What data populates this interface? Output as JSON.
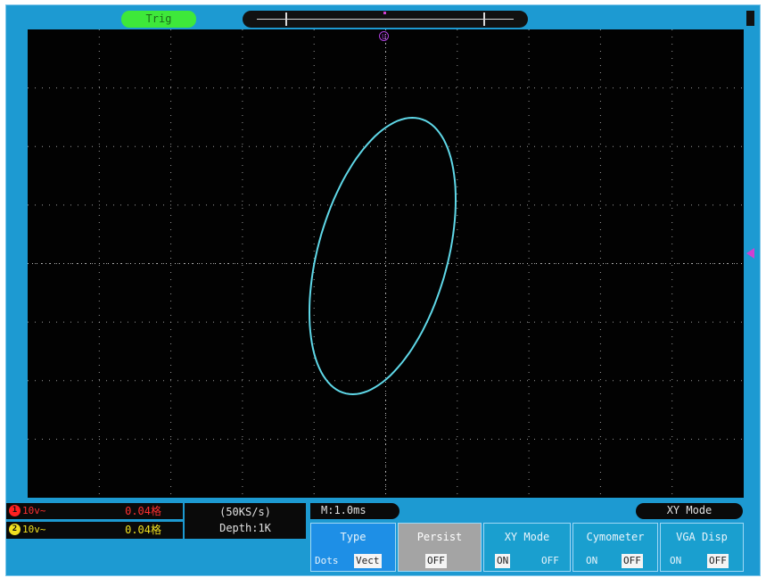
{
  "top": {
    "trig_label": "Trig"
  },
  "markers": {
    "trigger_marker": "U"
  },
  "channels": [
    {
      "number": "1",
      "setting": "10v~",
      "value": "0.04格",
      "color": "#ff2020"
    },
    {
      "number": "2",
      "setting": "10v~",
      "value": "0.04格",
      "color": "#f0e020"
    }
  ],
  "sample": {
    "rate": "(50KS/s)",
    "depth": "Depth:1K"
  },
  "timebase": "M:1.0ms",
  "mode_label": "XY Mode",
  "menu": {
    "type": {
      "title": "Type",
      "options": [
        "Dots",
        "Vect"
      ]
    },
    "persist": {
      "title": "Persist",
      "value": "OFF"
    },
    "xy_mode": {
      "title": "XY Mode",
      "options": [
        "ON",
        "OFF"
      ]
    },
    "cymometer": {
      "title": "Cymometer",
      "options": [
        "ON",
        "OFF"
      ]
    },
    "vga_disp": {
      "title": "VGA Disp",
      "options": [
        "ON",
        "OFF"
      ]
    }
  },
  "colors": {
    "frame": "#1d9ad2",
    "trace": "#5fd8e8",
    "trig_active": "#3ee83a"
  }
}
